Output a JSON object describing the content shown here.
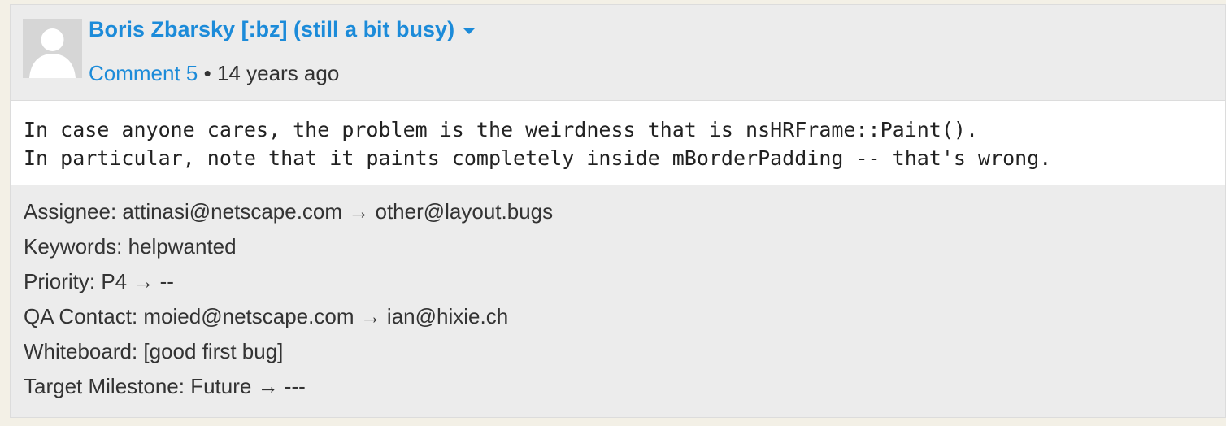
{
  "comment": {
    "author": "Boris Zbarsky [:bz] (still a bit busy)",
    "comment_link": "Comment 5",
    "separator": "•",
    "time": "14 years ago",
    "text_lines": [
      "In case anyone cares, the problem is the weirdness that is nsHRFrame::Paint().",
      "In particular, note that it paints completely inside mBorderPadding -- that's wrong."
    ],
    "changes": [
      "Assignee: attinasi@netscape.com → other@layout.bugs",
      "Keywords: helpwanted",
      "Priority: P4 → --",
      "QA Contact: moied@netscape.com → ian@hixie.ch",
      "Whiteboard: [good first bug]",
      "Target Milestone: Future → ---"
    ]
  },
  "icons": {
    "avatar": "default-user-avatar-icon",
    "author_menu": "caret-down-icon"
  },
  "colors": {
    "link": "#1c8bd9",
    "card_background": "#ececec",
    "page_background": "#f3f0e6"
  }
}
